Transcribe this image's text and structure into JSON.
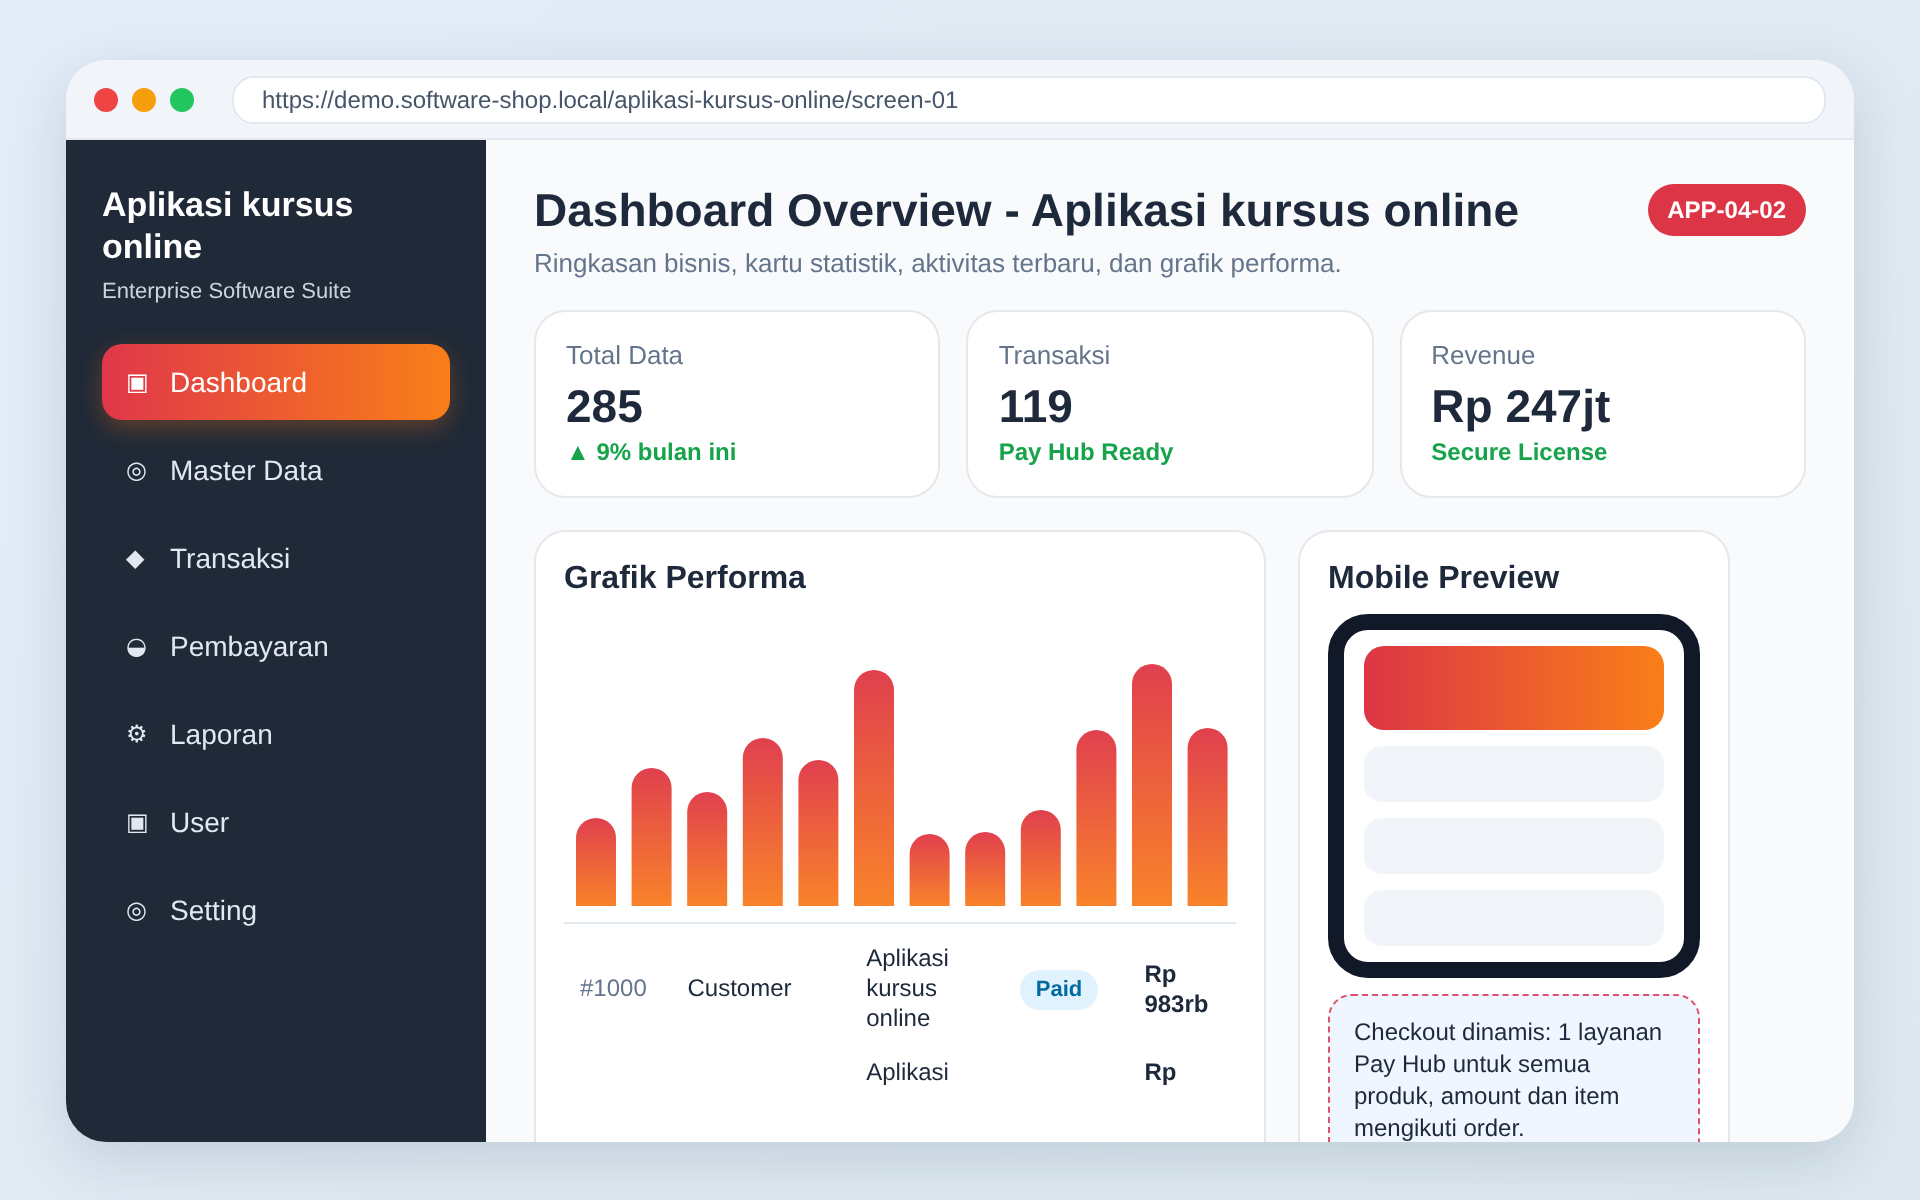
{
  "browser": {
    "url": "https://demo.software-shop.local/aplikasi-kursus-online/screen-01"
  },
  "sidebar": {
    "title": "Aplikasi kursus online",
    "subtitle": "Enterprise Software Suite",
    "items": [
      {
        "icon": "▣",
        "label": "Dashboard",
        "selected": true
      },
      {
        "icon": "◎",
        "label": "Master Data",
        "selected": false
      },
      {
        "icon": "◆",
        "label": "Transaksi",
        "selected": false
      },
      {
        "icon": "◒",
        "label": "Pembayaran",
        "selected": false
      },
      {
        "icon": "⚙",
        "label": "Laporan",
        "selected": false
      },
      {
        "icon": "▣",
        "label": "User",
        "selected": false
      },
      {
        "icon": "◎",
        "label": "Setting",
        "selected": false
      }
    ]
  },
  "header": {
    "title": "Dashboard Overview - Aplikasi kursus online",
    "subtitle": "Ringkasan bisnis, kartu statistik, aktivitas terbaru, dan grafik performa.",
    "badge": "APP-04-02"
  },
  "stats": [
    {
      "label": "Total Data",
      "value": "285",
      "note": "▲ 9% bulan ini"
    },
    {
      "label": "Transaksi",
      "value": "119",
      "note": "Pay Hub Ready"
    },
    {
      "label": "Revenue",
      "value": "Rp 247jt",
      "note": "Secure License"
    }
  ],
  "chart_panel": {
    "title": "Grafik Performa"
  },
  "orders": [
    {
      "id": "#1000",
      "customer": "Customer",
      "product": "Aplikasi kursus online",
      "status": "Paid",
      "amount": "Rp 983rb"
    },
    {
      "product": "Aplikasi",
      "amount": "Rp"
    }
  ],
  "mobile_preview": {
    "title": "Mobile Preview",
    "note": "Checkout dinamis: 1 layanan Pay Hub untuk semua produk, amount dan item mengikuti order."
  }
}
